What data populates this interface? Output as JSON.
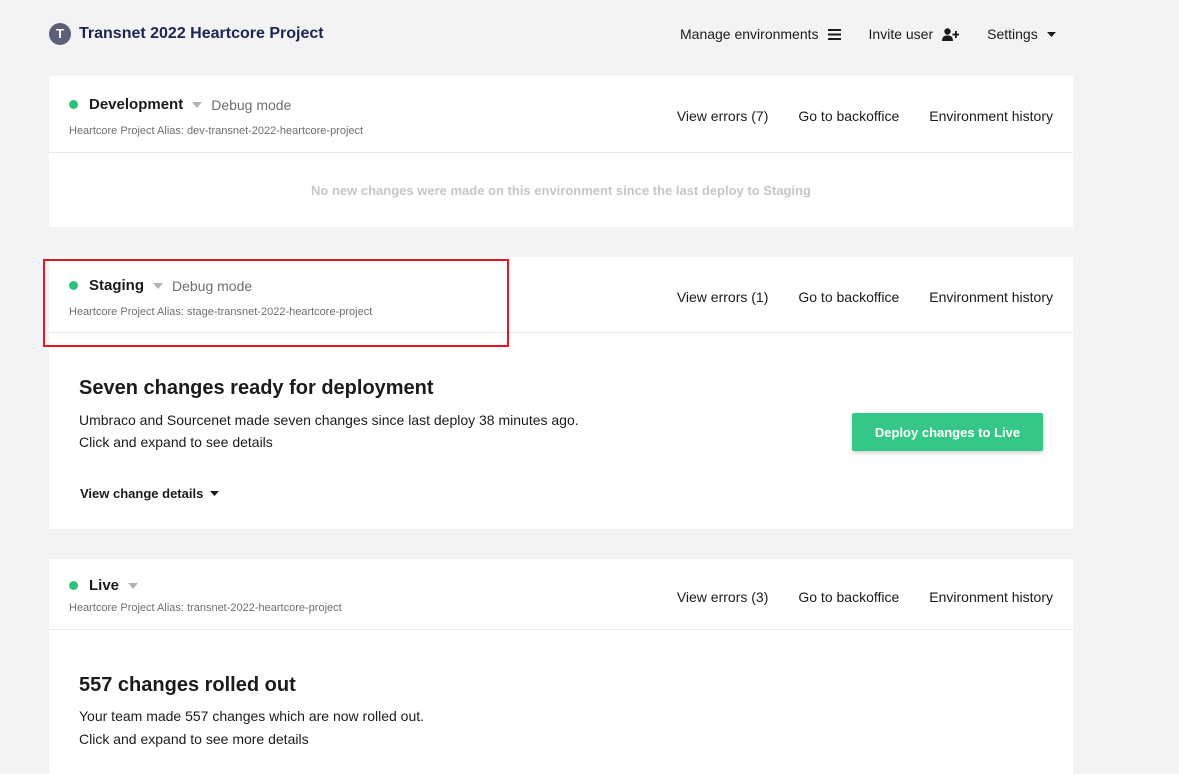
{
  "header": {
    "logo_letter": "T",
    "project_title": "Transnet 2022 Heartcore Project",
    "nav": {
      "manage_environments": "Manage environments",
      "invite_user": "Invite user",
      "settings": "Settings"
    }
  },
  "environments": [
    {
      "name": "Development",
      "debug_label": "Debug mode",
      "alias": "Heartcore Project Alias: dev-transnet-2022-heartcore-project",
      "actions": {
        "view_errors": "View errors (7)",
        "backoffice": "Go to backoffice",
        "history": "Environment history"
      },
      "empty_message": "No new changes were made on this environment since the last deploy to Staging"
    },
    {
      "name": "Staging",
      "debug_label": "Debug mode",
      "alias": "Heartcore Project Alias: stage-transnet-2022-heartcore-project",
      "actions": {
        "view_errors": "View errors (1)",
        "backoffice": "Go to backoffice",
        "history": "Environment history"
      },
      "title": "Seven changes ready for deployment",
      "line1": "Umbraco and Sourcenet made seven changes since last deploy 38 minutes ago.",
      "line2": "Click and expand to see details",
      "deploy_button": "Deploy changes to Live",
      "details_toggle": "View change details"
    },
    {
      "name": "Live",
      "alias": "Heartcore Project Alias: transnet-2022-heartcore-project",
      "actions": {
        "view_errors": "View errors (3)",
        "backoffice": "Go to backoffice",
        "history": "Environment history"
      },
      "title": "557 changes rolled out",
      "line1": "Your team made 557 changes which are now rolled out.",
      "line2": "Click and expand to see more details"
    }
  ],
  "colors": {
    "status_ok": "#2bc37c",
    "deploy_button": "#35c786",
    "highlight": "#e4161f",
    "title": "#1b264f"
  }
}
